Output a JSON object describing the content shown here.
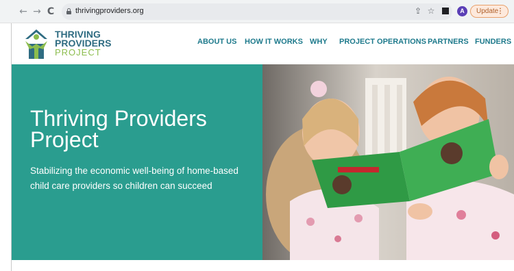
{
  "browser": {
    "url": "thrivingproviders.org",
    "avatar_letter": "A",
    "update_label": "Update",
    "update_menu": "⋮",
    "icons": {
      "back": "back-arrow-icon",
      "forward": "forward-arrow-icon",
      "reload": "reload-icon",
      "lock": "lock-icon",
      "share": "share-icon",
      "bookmark": "star-icon",
      "sidebar": "sidebar-icon"
    }
  },
  "site": {
    "logo": {
      "line1": "THRIVING",
      "line2": "PROVIDERS",
      "line3": "PROJECT"
    },
    "nav": [
      {
        "label": "ABOUT US"
      },
      {
        "label": "HOW IT WORKS"
      },
      {
        "label": "WHY"
      },
      {
        "label": "PROJECT OPERATIONS"
      },
      {
        "label": "PARTNERS"
      },
      {
        "label": "FUNDERS"
      }
    ],
    "hero": {
      "title": "Thriving Providers Project",
      "subtitle": "Stabilizing the economic well-being of home-based child care providers so children can succeed"
    }
  },
  "colors": {
    "teal": "#2a9d8f",
    "nav_text": "#1e7a8c",
    "logo_blue": "#2f6c82",
    "logo_green": "#8cbd4e",
    "update_orange": "#e8a06b"
  }
}
